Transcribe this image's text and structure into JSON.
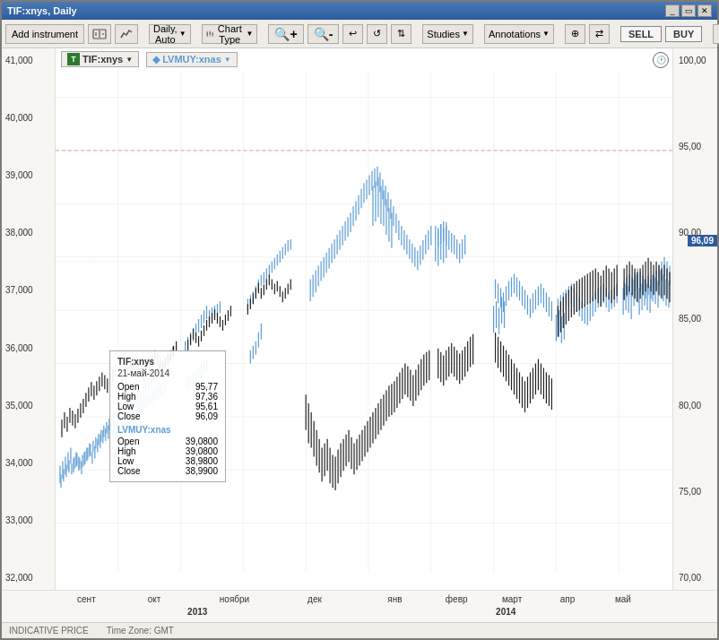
{
  "window": {
    "title": "TIF:xnys, Daily"
  },
  "toolbar": {
    "add_instrument": "Add instrument",
    "period": "Daily, Auto",
    "chart_type": "Chart Type",
    "studies": "Studies",
    "annotations": "Annotations",
    "sell": "SELL",
    "buy": "BUY"
  },
  "symbols": [
    {
      "name": "TIF:xnys",
      "color": "#000000",
      "icon": "T"
    },
    {
      "name": "LVMUY:xnas",
      "color": "#5b9bd5",
      "icon": "L"
    }
  ],
  "tooltip": {
    "symbol1": "TIF:xnys",
    "date": "21-май-2014",
    "open1": "95,77",
    "high1": "97,36",
    "low1": "95,61",
    "close1": "96,09",
    "symbol2": "LVMUY:xnas",
    "open2": "39,0800",
    "high2": "39,0800",
    "low2": "38,9800",
    "close2": "38,9900"
  },
  "price_badge": "96,09",
  "y_axis_left": [
    "41,000",
    "40,000",
    "39,000",
    "38,000",
    "37,000",
    "36,000",
    "35,000",
    "34,000",
    "33,000",
    "32,000"
  ],
  "y_axis_right": [
    "100,00",
    "95,00",
    "90,00",
    "85,00",
    "80,00",
    "75,00",
    "70,00"
  ],
  "x_axis": {
    "labels_2013": [
      "сент",
      "окт",
      "ноябри",
      "дек"
    ],
    "labels_2014": [
      "янв",
      "февр",
      "март",
      "апр",
      "май"
    ],
    "year2013": "2013",
    "year2014": "2014"
  },
  "status_bar": {
    "indicative": "INDICATIVE PRICE",
    "timezone": "Time Zone: GMT"
  }
}
